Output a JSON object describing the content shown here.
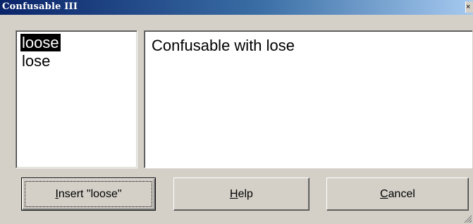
{
  "window": {
    "title": "Confusable III",
    "close_glyph": "×"
  },
  "list": {
    "items": [
      {
        "label": "loose",
        "selected": true
      },
      {
        "label": "lose",
        "selected": false
      }
    ]
  },
  "info": {
    "text": "Confusable with lose"
  },
  "buttons": {
    "insert": {
      "prefix": "",
      "mnemonic": "I",
      "rest": "nsert \"loose\""
    },
    "help": {
      "prefix": "",
      "mnemonic": "H",
      "rest": "elp"
    },
    "cancel": {
      "prefix": "",
      "mnemonic": "C",
      "rest": "ancel"
    }
  },
  "colors": {
    "titlebar_start": "#0a246a",
    "titlebar_end": "#a6caf0",
    "face": "#d4d0c8",
    "selection": "#000000"
  }
}
